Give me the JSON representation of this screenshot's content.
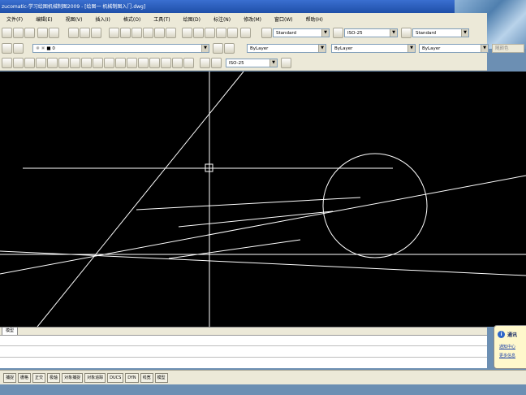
{
  "window": {
    "title": "zucomatic-学习绘图机械制图2009 - [绘图一 机械制图入门.dwg]"
  },
  "menu": {
    "items": [
      "文件(F)",
      "编辑(E)",
      "视图(V)",
      "插入(I)",
      "格式(O)",
      "工具(T)",
      "绘图(D)",
      "标注(N)",
      "修改(M)",
      "窗口(W)",
      "帮助(H)"
    ]
  },
  "toolbar_styles": {
    "text_style": "Standard",
    "dim_style": "ISO-25",
    "table_style": "Standard"
  },
  "layers_toolbar": {
    "layer_value": "0"
  },
  "properties_toolbar": {
    "color": "ByLayer",
    "linetype": "ByLayer",
    "lineweight": "ByLayer",
    "plot_style": "随颜色"
  },
  "dim_toolbar": {
    "dim_style_value": "ISO-25"
  },
  "layout_tabs": {
    "model_label": "模型"
  },
  "notification": {
    "title": "通讯",
    "link_1": "通知中心",
    "link_2": "更多信息"
  },
  "status_bar": {
    "toggles": [
      "捕捉",
      "栅格",
      "正交",
      "极轴",
      "对象捕捉",
      "对象追踪",
      "DUCS",
      "DYN",
      "线宽",
      "模型"
    ]
  },
  "colors": {
    "canvas_background": "#000000",
    "drawing_lines": "#ffffff",
    "chrome": "#ece9d8",
    "titlebar": "#1f4fa8"
  }
}
